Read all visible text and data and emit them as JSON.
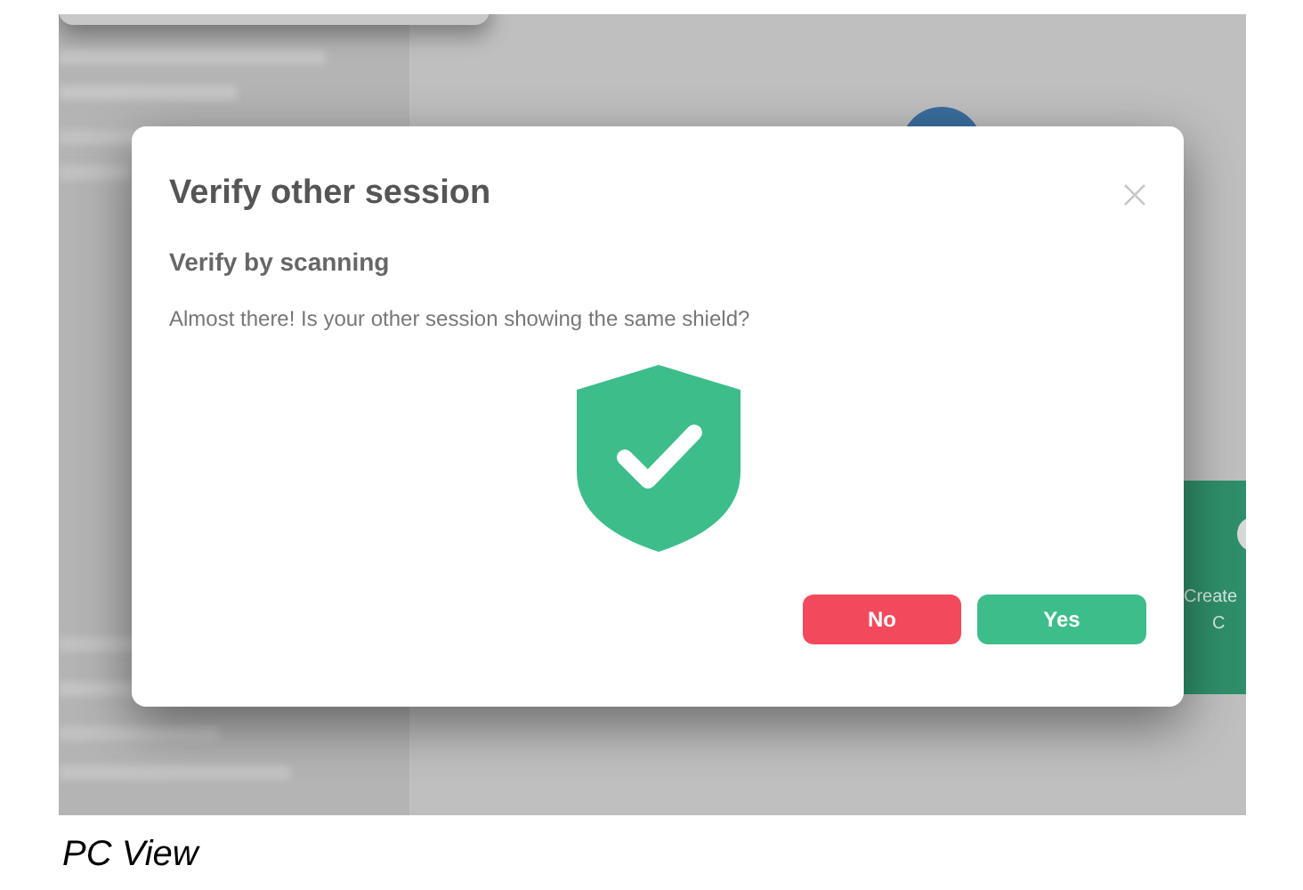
{
  "background": {
    "action_card": {
      "lines": [
        "Create",
        "C"
      ]
    }
  },
  "dialog": {
    "title": "Verify other session",
    "subtitle": "Verify by scanning",
    "message": "Almost there! Is your other session showing the same shield?",
    "buttons": [
      {
        "label": "No",
        "kind": "danger"
      },
      {
        "label": "Yes",
        "kind": "confirm"
      }
    ]
  },
  "caption": "PC View"
}
